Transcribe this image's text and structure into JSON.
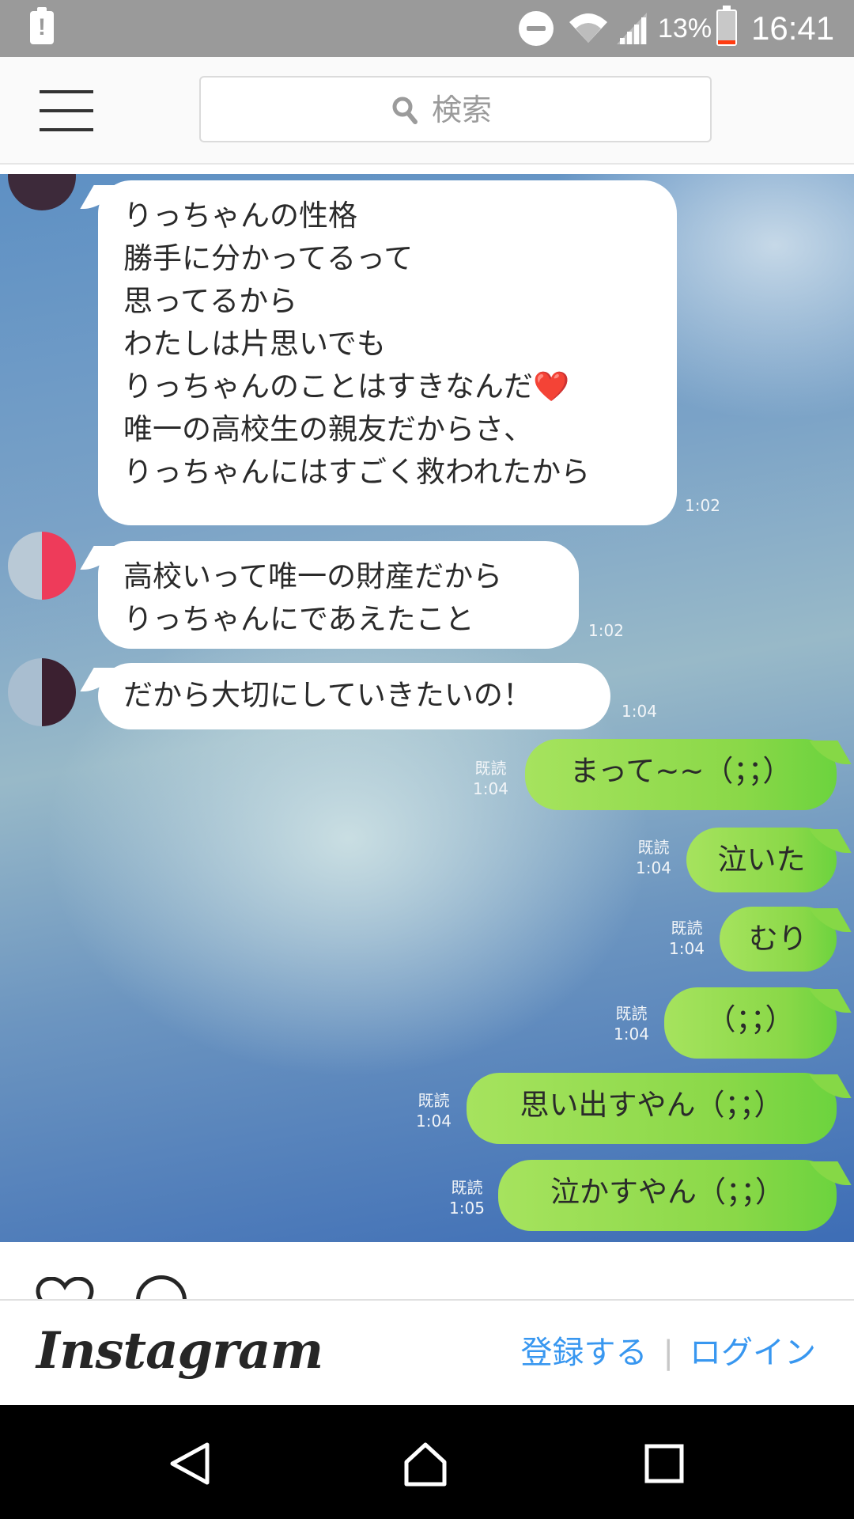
{
  "status_bar": {
    "alert_glyph": "!",
    "battery_percent": "13%",
    "battery_level": 0.13,
    "time": "16:41",
    "icons": [
      "alert-icon",
      "do-not-disturb-icon",
      "wifi-icon",
      "signal-icon",
      "battery-icon"
    ]
  },
  "header": {
    "search_placeholder": "検索",
    "icons": [
      "menu-icon",
      "search-icon"
    ]
  },
  "chat": {
    "incoming": [
      {
        "text": "りっちゃんの性格\n勝手に分かってるって\n思ってるから\nわたしは片思いでも\nりっちゃんのことはすきなんだ❤️\n唯一の高校生の親友だからさ、\nりっちゃんにはすごく救われたから",
        "time": "1:02"
      },
      {
        "text": "高校いって唯一の財産だから\nりっちゃんにであえたこと",
        "time": "1:02"
      },
      {
        "text": "だから大切にしていきたいの！",
        "time": "1:04"
      }
    ],
    "outgoing": [
      {
        "read": "既読",
        "time": "1:04",
        "text": "まって~~（；；）"
      },
      {
        "read": "既読",
        "time": "1:04",
        "text": "泣いた"
      },
      {
        "read": "既読",
        "time": "1:04",
        "text": "むり"
      },
      {
        "read": "既読",
        "time": "1:04",
        "text": "（；；）"
      },
      {
        "read": "既読",
        "time": "1:04",
        "text": "思い出すやん（；；）"
      },
      {
        "read": "既読",
        "time": "1:05",
        "text": "泣かすやん（；；）"
      }
    ],
    "colors": {
      "outgoing_bubble": "#8ad848",
      "incoming_bubble": "#ffffff"
    }
  },
  "post_actions": {
    "icons": [
      "heart-icon",
      "comment-icon"
    ]
  },
  "instagram_bar": {
    "logo": "Instagram",
    "signup": "登録する",
    "separator": "|",
    "login": "ログイン",
    "link_color": "#3897f0"
  },
  "nav_bar": {
    "icons": [
      "back-icon",
      "home-icon",
      "recents-icon"
    ]
  }
}
